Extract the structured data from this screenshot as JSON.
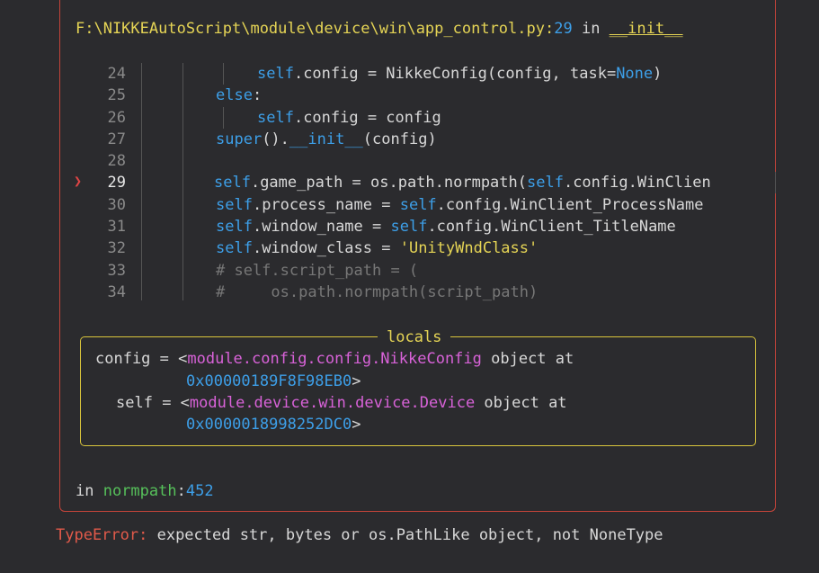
{
  "header": {
    "file_path": "F:\\NIKKEAutoScript\\module\\device\\win\\app_control.py",
    "colon": ":",
    "line_no": "29",
    "in_word": " in ",
    "func": "__init__"
  },
  "code_lines": [
    {
      "num": "24",
      "text": "self.config = NikkeConfig(config, task=None)"
    },
    {
      "num": "25",
      "text": "else:"
    },
    {
      "num": "26",
      "text": "self.config = config"
    },
    {
      "num": "27",
      "text": "super().__init__(config)"
    },
    {
      "num": "28",
      "text": ""
    },
    {
      "num": "29",
      "text": "self.game_path = os.path.normpath(self.config.WinClien"
    },
    {
      "num": "30",
      "text": "self.process_name = self.config.WinClient_ProcessName"
    },
    {
      "num": "31",
      "text": "self.window_name = self.config.WinClient_TitleName"
    },
    {
      "num": "32",
      "text": "self.window_class = 'UnityWndClass'"
    },
    {
      "num": "33",
      "text": "# self.script_path = ("
    },
    {
      "num": "34",
      "text": "#     os.path.normpath(script_path)"
    }
  ],
  "current_marker": "❯",
  "locals": {
    "title": "locals",
    "config_name": "config",
    "config_eq": " = <",
    "config_module": "module.config.config.NikkeConfig",
    "config_obj": " object at",
    "config_addr": "0x00000189F8F98EB0",
    "config_close": ">",
    "self_name": "self",
    "self_eq": " = <",
    "self_module": "module.device.win.device.Device",
    "self_obj": " object at",
    "self_addr": "0x0000018998252DC0",
    "self_close": ">"
  },
  "footer": {
    "in_word": "in ",
    "func": "normpath",
    "colon": ":",
    "line_no": "452"
  },
  "error": {
    "type": "TypeError:",
    "message": " expected str, bytes or os.PathLike object, not NoneType"
  },
  "colors": {
    "border": "#c5443a",
    "path": "#e5d455",
    "blue": "#3d9fe8",
    "magenta": "#d862d8",
    "green": "#56c05a",
    "error": "#e25a4a"
  }
}
